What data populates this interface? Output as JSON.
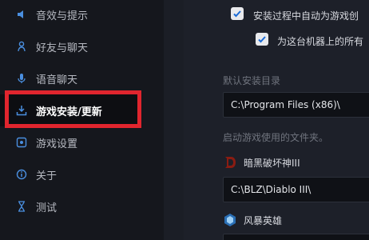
{
  "sidebar": {
    "items": [
      {
        "label": "音效与提示",
        "icon": "speaker-icon"
      },
      {
        "label": "好友与聊天",
        "icon": "person-icon"
      },
      {
        "label": "语音聊天",
        "icon": "microphone-icon"
      },
      {
        "label": "游戏安装/更新",
        "icon": "download-icon"
      },
      {
        "label": "游戏设置",
        "icon": "gear-icon"
      },
      {
        "label": "关于",
        "icon": "info-icon"
      },
      {
        "label": "测试",
        "icon": "hourglass-icon"
      }
    ],
    "active_index": 3
  },
  "settings": {
    "auto_create_shortcut": {
      "label": "安装过程中自动为游戏创",
      "checked": true
    },
    "all_users": {
      "label": "为这台机器上的所有",
      "checked": true
    },
    "default_install_dir": {
      "label": "默认安装目录",
      "value": "C:\\Program Files (x86)\\"
    },
    "game_folders_label": "启动游戏使用的文件夹。",
    "games": [
      {
        "name": "暗黑破坏神III",
        "path": "C:\\BLZ\\Diablo III\\",
        "icon": "diablo-icon"
      },
      {
        "name": "风暴英雄",
        "icon": "heroes-icon"
      }
    ]
  },
  "colors": {
    "highlight": "#e0252e",
    "accent_blue": "#1a6ad6"
  }
}
